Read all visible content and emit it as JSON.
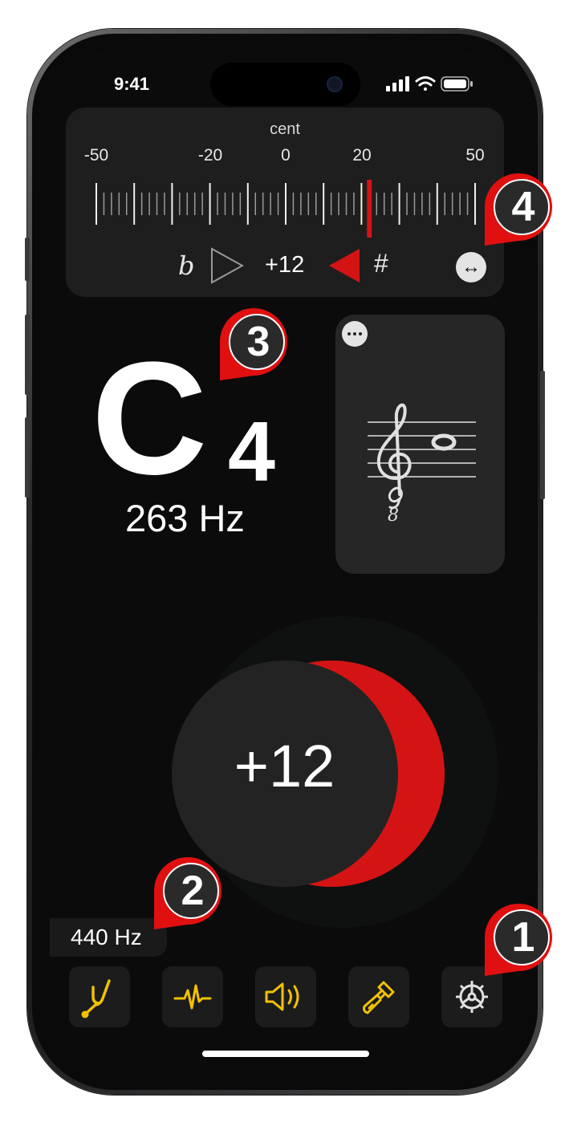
{
  "status_bar": {
    "time": "9:41"
  },
  "cent_panel": {
    "title": "cent",
    "scale_labels": [
      "-50",
      "-20",
      "0",
      "20",
      "50"
    ],
    "flat_sign": "b",
    "sharp_sign": "#",
    "value": "+12",
    "swap_icon": "↔"
  },
  "note": {
    "name": "C",
    "octave": "4",
    "frequency": "263 Hz"
  },
  "dial": {
    "value": "+12"
  },
  "reference": {
    "label": "440 Hz"
  },
  "toolbar": {
    "icons": [
      "tuning-fork-icon",
      "waveform-icon",
      "speaker-icon",
      "paintbrush-icon",
      "gear-icon"
    ]
  },
  "callouts": [
    "1",
    "2",
    "3",
    "4"
  ],
  "colors": {
    "accent_red": "#d41414",
    "icon_yellow": "#f2c200",
    "panel": "#1e1e1e"
  }
}
